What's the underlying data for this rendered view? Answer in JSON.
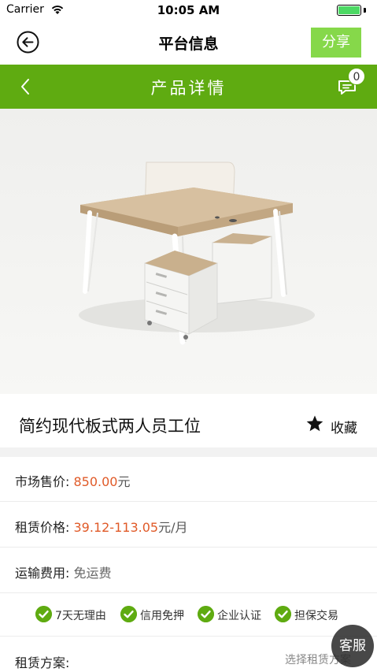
{
  "status_bar": {
    "carrier": "Carrier",
    "time": "10:05 AM",
    "battery_level": 1.0
  },
  "nav": {
    "title": "平台信息",
    "share_label": "分享"
  },
  "header": {
    "title": "产品详情",
    "message_count": "0"
  },
  "product": {
    "title": "简约现代板式两人员工位",
    "favorite_label": "收藏"
  },
  "details": {
    "market_price": {
      "label": "市场售价:",
      "value": "850.00",
      "unit": "元"
    },
    "rent_price": {
      "label": "租赁价格:",
      "value": "39.12-113.05",
      "unit": "元/月"
    },
    "shipping": {
      "label": "运输费用:",
      "value": "免运费"
    }
  },
  "guarantees": [
    {
      "label": "7天无理由"
    },
    {
      "label": "信用免押"
    },
    {
      "label": "企业认证"
    },
    {
      "label": "担保交易"
    }
  ],
  "plan": {
    "label": "租赁方案:",
    "select_text": "选择租赁方案"
  },
  "service_button": "客服",
  "colors": {
    "brand_green": "#5fab11",
    "share_green": "#86d84a",
    "price_red": "#e05a28"
  }
}
